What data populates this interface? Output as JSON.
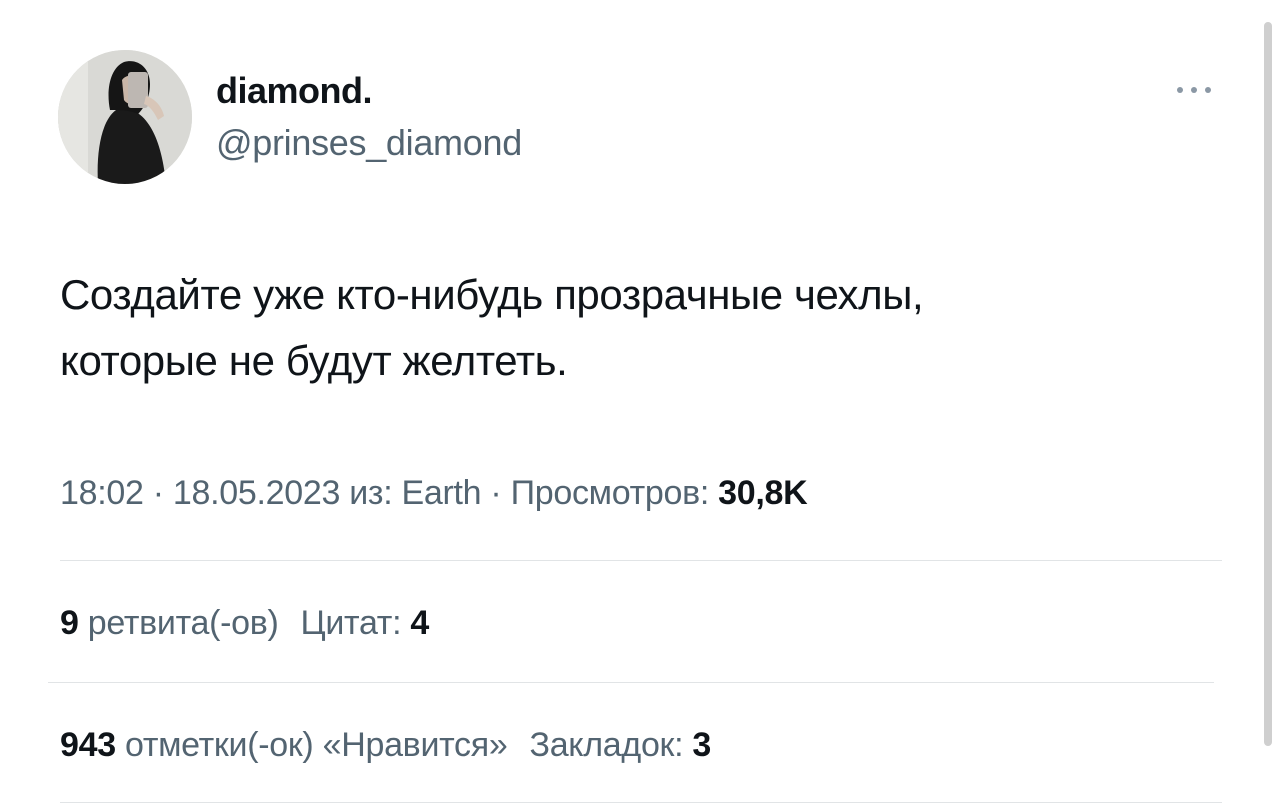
{
  "author": {
    "display_name": "diamond.",
    "handle": "@prinses_diamond",
    "avatar_icon": "user-avatar-photo"
  },
  "more_icon": "more-horizontal-icon",
  "tweet": {
    "line1": "Создайте уже кто-нибудь прозрачные чехлы,",
    "line2": "которые не будут желтеть."
  },
  "meta": {
    "time": "18:02",
    "separator1": " · ",
    "date": "18.05.2023",
    "source_prefix": " из: ",
    "source": "Earth",
    "separator2": " · ",
    "views_label": "Просмотров: ",
    "views_value": "30,8K"
  },
  "stats": {
    "retweets_count": "9",
    "retweets_label": " ретвита(-ов)",
    "quotes_label": "Цитат: ",
    "quotes_count": "4",
    "likes_count": "943",
    "likes_label": " отметки(-ок) «Нравится»",
    "bookmarks_label": "Закладок: ",
    "bookmarks_count": "3"
  },
  "colors": {
    "text_primary": "#0f1419",
    "text_secondary": "#536471",
    "divider": "#e1e4e6"
  }
}
